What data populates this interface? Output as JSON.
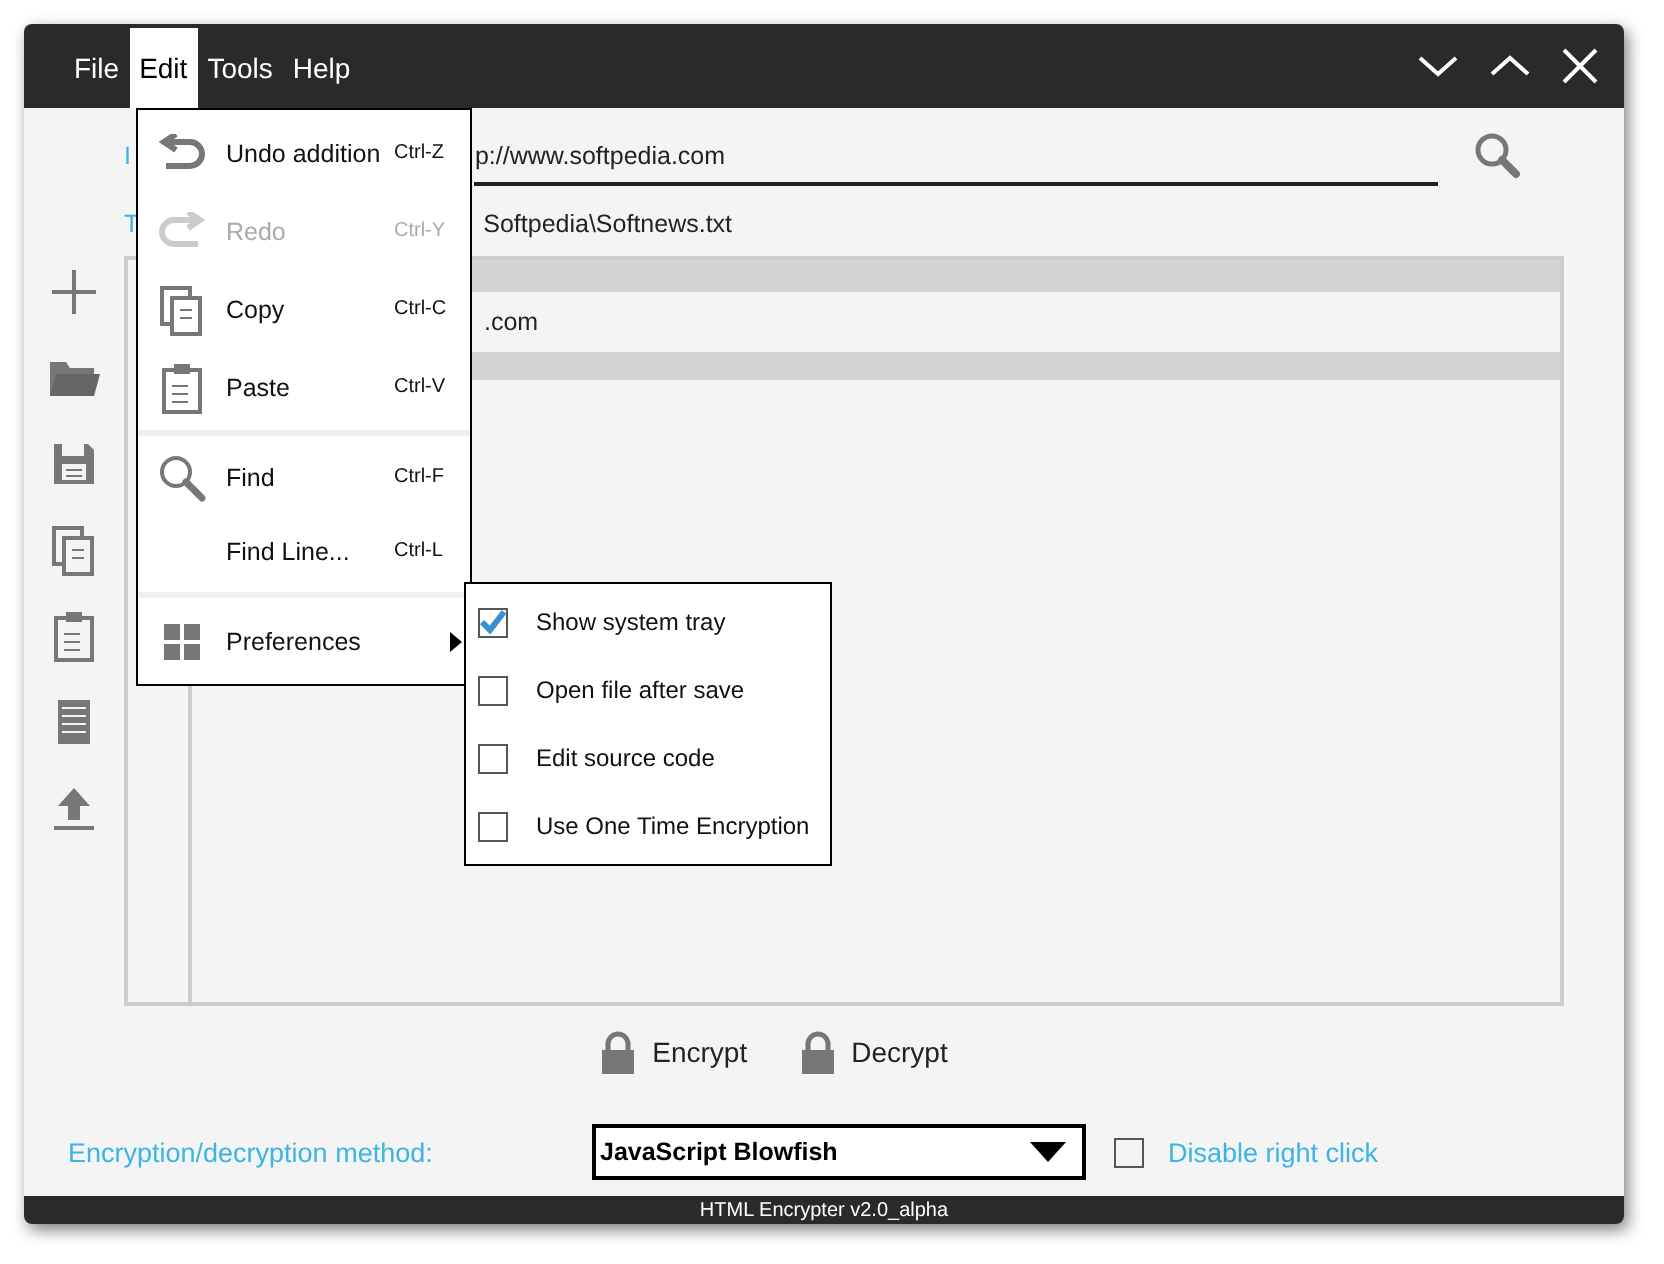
{
  "menu_bar": [
    {
      "label": "File",
      "selected": false
    },
    {
      "label": "Edit",
      "selected": true
    },
    {
      "label": "Tools",
      "selected": false
    },
    {
      "label": "Help",
      "selected": false
    }
  ],
  "url_row": {
    "label": "I",
    "value": "p://www.softpedia.com"
  },
  "file_row": {
    "label": "T",
    "value": "Softpedia\\Softnews.txt"
  },
  "text_area": {
    "lines": [
      ".com"
    ]
  },
  "buttons": [
    "Encrypt",
    "Decrypt"
  ],
  "method": {
    "label": "Encryption/decryption method:",
    "value": "JavaScript Blowfish"
  },
  "disable_right_click": {
    "label": "Disable right click",
    "checked": false
  },
  "status_bar": "HTML Encrypter v2.0_alpha",
  "edit_menu": {
    "groups": [
      [
        {
          "label": "Undo addition",
          "shortcut": "Ctrl-Z",
          "disabled": false,
          "submenu": false
        },
        {
          "label": "Redo",
          "shortcut": "Ctrl-Y",
          "disabled": true,
          "submenu": false
        },
        {
          "label": "Copy",
          "shortcut": "Ctrl-C",
          "disabled": false,
          "submenu": false
        },
        {
          "label": "Paste",
          "shortcut": "Ctrl-V",
          "disabled": false,
          "submenu": false
        }
      ],
      [
        {
          "label": "Find",
          "shortcut": "Ctrl-F",
          "disabled": false,
          "submenu": false
        },
        {
          "label": "Find Line...",
          "shortcut": "Ctrl-L",
          "disabled": false,
          "submenu": false
        }
      ],
      [
        {
          "label": "Preferences",
          "disabled": false,
          "submenu": true
        }
      ]
    ]
  },
  "preferences_menu": [
    {
      "label": "Show system tray",
      "checked": true
    },
    {
      "label": "Open file after save",
      "checked": false
    },
    {
      "label": "Edit source code",
      "checked": false
    },
    {
      "label": "Use One Time Encryption",
      "checked": false
    }
  ]
}
